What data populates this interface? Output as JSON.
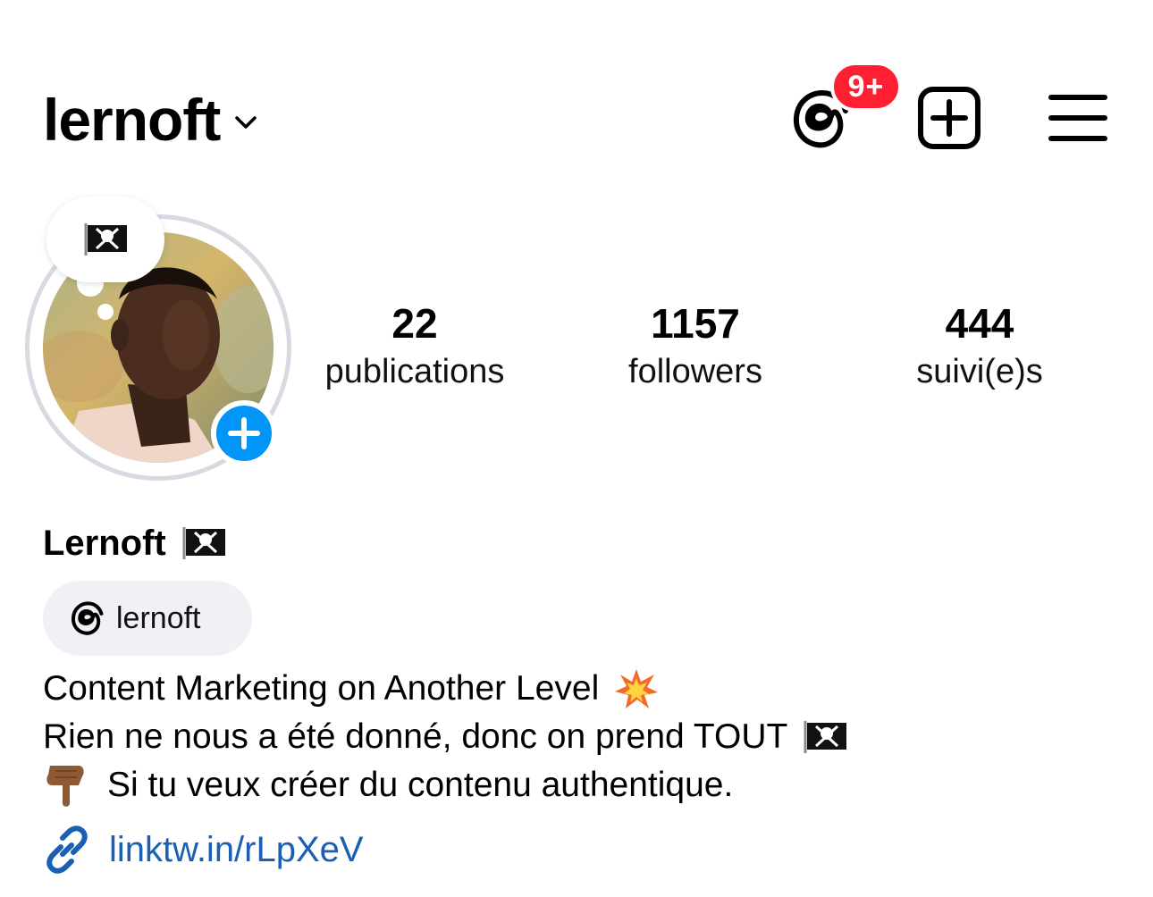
{
  "header": {
    "username": "lernoft",
    "notification_badge": "9+",
    "icons": {
      "username_dropdown": "chevron-down-icon",
      "threads": "threads-icon",
      "create": "plus-square-icon",
      "menu": "hamburger-menu-icon"
    }
  },
  "profile": {
    "note_emoji": "pirate-flag-icon",
    "add_story_icon": "plus-icon",
    "stats": [
      {
        "count": "22",
        "label": "publications"
      },
      {
        "count": "1157",
        "label": "followers"
      },
      {
        "count": "444",
        "label": "suivi(e)s"
      }
    ]
  },
  "bio": {
    "display_name": "Lernoft",
    "threads_chip_label": "lernoft",
    "lines": [
      "Content Marketing on Another Level",
      "Rien ne nous a été donné, donc on prend TOUT",
      "Si tu veux créer du contenu authentique."
    ],
    "link": "linktw.in/rLpXeV"
  },
  "colors": {
    "badge_red": "#ff1f33",
    "add_story_blue": "#0095f6",
    "link_blue": "#1a5fb4",
    "chip_bg": "#eff1f4",
    "ring_gray": "#d6dbe1"
  }
}
